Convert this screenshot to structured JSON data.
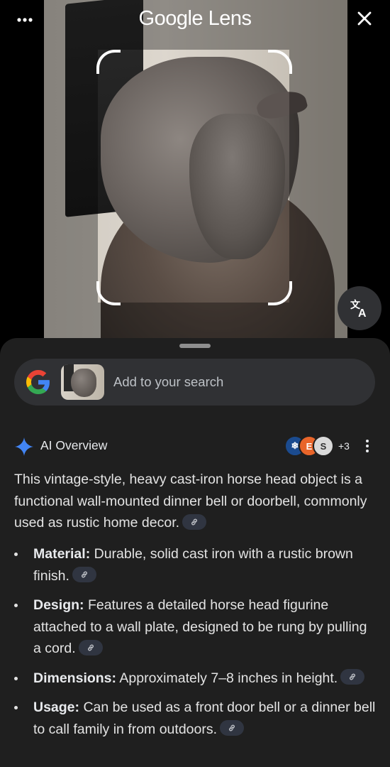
{
  "header": {
    "title": "Google Lens",
    "menu_icon": "more-horizontal-icon",
    "close_icon": "close-icon"
  },
  "translate_icon": "translate-icon",
  "search": {
    "placeholder": "Add to your search"
  },
  "ai_overview": {
    "label": "AI Overview",
    "sources_more": "+3",
    "intro": "This vintage-style, heavy cast-iron horse head object is a functional wall-mounted dinner bell or doorbell, commonly used as rustic home decor.",
    "bullets": [
      {
        "term": "Material:",
        "text": "Durable, solid cast iron with a rustic brown finish."
      },
      {
        "term": "Design:",
        "text": "Features a detailed horse head figurine attached to a wall plate, designed to be rung by pulling a cord."
      },
      {
        "term": "Dimensions:",
        "text": "Approximately 7–8 inches in height."
      },
      {
        "term": "Usage:",
        "text": "Can be used as a front door bell or a dinner bell to call family in from outdoors."
      }
    ]
  },
  "colors": {
    "sheet_bg": "#1f1f1f",
    "search_bg": "#303134",
    "sparkle": "#4285f4"
  }
}
